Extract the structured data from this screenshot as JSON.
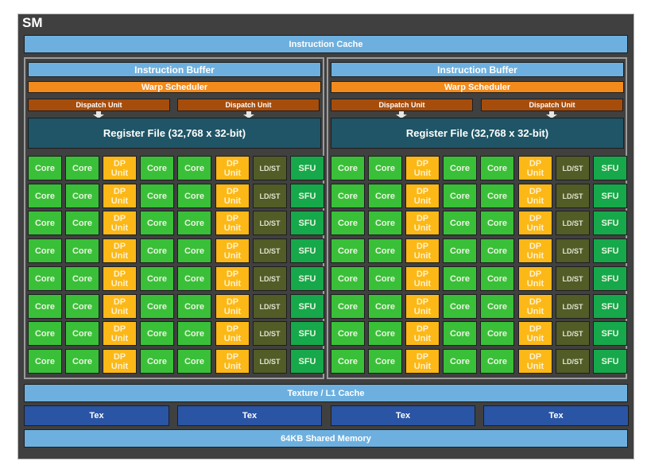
{
  "title": "SM",
  "instruction_cache": "Instruction Cache",
  "panels": [
    {
      "instruction_buffer": "Instruction Buffer",
      "warp_scheduler": "Warp Scheduler",
      "dispatch_units": [
        "Dispatch Unit",
        "Dispatch Unit"
      ],
      "register_file": "Register File (32,768 x 32-bit)"
    },
    {
      "instruction_buffer": "Instruction Buffer",
      "warp_scheduler": "Warp Scheduler",
      "dispatch_units": [
        "Dispatch Unit",
        "Dispatch Unit"
      ],
      "register_file": "Register File (32,768 x 32-bit)"
    }
  ],
  "unit_grid": {
    "rows_per_panel": 8,
    "columns": [
      {
        "type": "core",
        "label": "Core"
      },
      {
        "type": "core",
        "label": "Core"
      },
      {
        "type": "dp",
        "label": "DP Unit"
      },
      {
        "type": "core",
        "label": "Core"
      },
      {
        "type": "core",
        "label": "Core"
      },
      {
        "type": "dp",
        "label": "DP Unit"
      },
      {
        "type": "ldst",
        "label": "LD/ST"
      },
      {
        "type": "sfu",
        "label": "SFU"
      }
    ]
  },
  "texture_l1_cache": "Texture / L1 Cache",
  "tex_units": [
    "Tex",
    "Tex",
    "Tex",
    "Tex"
  ],
  "shared_memory": "64KB Shared Memory",
  "colors": {
    "frame": "#404040",
    "cache": "#6db0df",
    "warp_scheduler": "#f28a1c",
    "dispatch": "#a64d0c",
    "register_file": "#1f5566",
    "core": "#3abf39",
    "dp_unit": "#fbb817",
    "ldst": "#515c27",
    "sfu": "#16a84a",
    "tex": "#2a54a4"
  }
}
